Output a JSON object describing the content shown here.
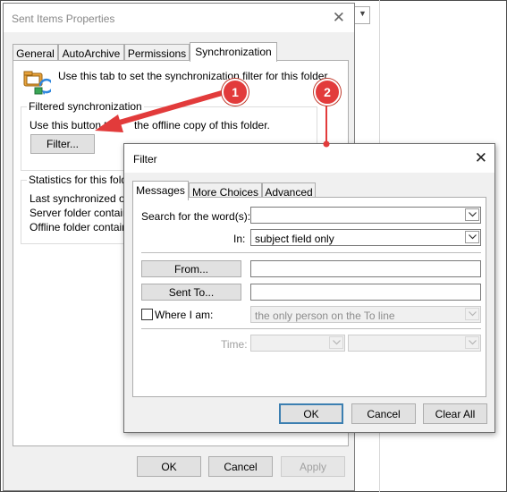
{
  "properties_window": {
    "title": "Sent Items Properties",
    "tabs": [
      {
        "label": "General",
        "active": false
      },
      {
        "label": "AutoArchive",
        "active": false
      },
      {
        "label": "Permissions",
        "active": false
      },
      {
        "label": "Synchronization",
        "active": true
      }
    ],
    "intro_text": "Use this tab to set the synchronization filter for this folder.",
    "filtered_sync": {
      "group_label": "Filtered synchronization",
      "description_start": "Use this button t",
      "description_end": "the offline copy of this folder.",
      "filter_button": "Filter..."
    },
    "statistics": {
      "group_label": "Statistics for this fold",
      "lines": [
        "Last synchronized on",
        "Server folder contain",
        "Offline folder contain"
      ]
    },
    "buttons": {
      "ok": "OK",
      "cancel": "Cancel",
      "apply": "Apply"
    }
  },
  "filter_window": {
    "title": "Filter",
    "tabs": [
      {
        "label": "Messages",
        "active": true
      },
      {
        "label": "More Choices",
        "active": false
      },
      {
        "label": "Advanced",
        "active": false
      }
    ],
    "search_label": "Search for the word(s):",
    "search_value": "",
    "in_label": "In:",
    "in_value": "subject field only",
    "from_button": "From...",
    "from_value": "",
    "sent_to_button": "Sent To...",
    "sent_to_value": "",
    "where_label": "Where I am:",
    "where_checked": false,
    "where_value": "the only person on the To line",
    "time_label": "Time:",
    "buttons": {
      "ok": "OK",
      "cancel": "Cancel",
      "clear_all": "Clear All"
    }
  },
  "callouts": [
    "1",
    "2"
  ],
  "colors": {
    "callout": "#e23b3b",
    "focus": "#3c7fb1"
  },
  "icons": [
    "close-icon",
    "sync-folder-icon",
    "chevron-down-icon",
    "arrow-pointer"
  ]
}
